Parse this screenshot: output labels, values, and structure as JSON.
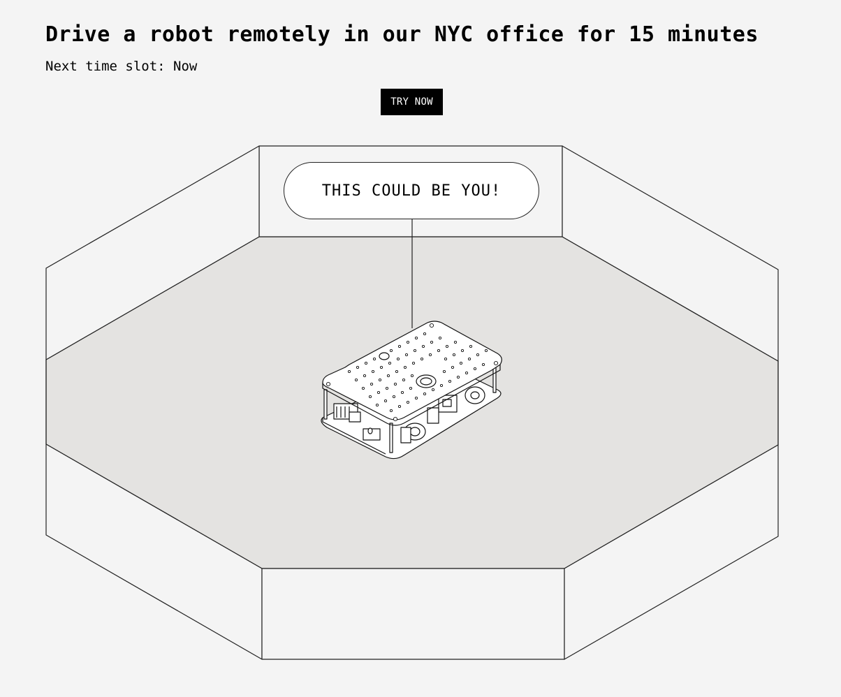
{
  "header": {
    "title": "Drive a robot remotely in our NYC office for 15 minutes",
    "slot_label": "Next time slot:",
    "slot_value": "Now"
  },
  "cta": {
    "label": "TRY NOW"
  },
  "scene": {
    "bubble_text": "THIS COULD BE YOU!"
  },
  "colors": {
    "background": "#f4f4f4",
    "floor": "#e4e3e1",
    "wall": "#f4f4f4",
    "button_bg": "#000000",
    "button_text": "#ffffff",
    "line": "#222222"
  }
}
